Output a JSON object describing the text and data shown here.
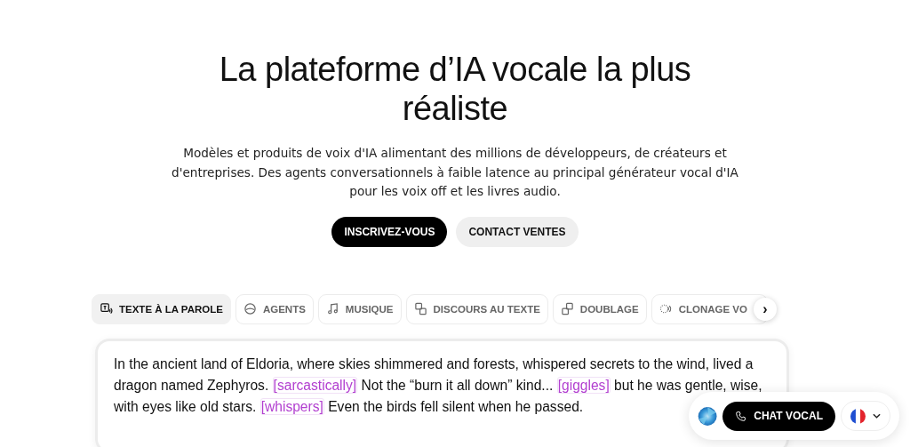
{
  "hero": {
    "title": "La plateforme d’IA vocale la plus réaliste",
    "subtitle": "Modèles et produits de voix d'IA alimentant des millions de développeurs, de créateurs et d'entreprises. Des agents conversationnels à faible latence au principal générateur vocal d'IA pour les voix off et les livres audio.",
    "buttons": [
      {
        "label": "INSCRIVEZ-VOUS",
        "kind": "primary"
      },
      {
        "label": "CONTACT VENTES",
        "kind": "secondary"
      }
    ]
  },
  "tabs": [
    {
      "label": "TEXTE À LA PAROLE",
      "kind": "tts",
      "selected": true
    },
    {
      "label": "AGENTS",
      "kind": "agents",
      "selected": false
    },
    {
      "label": "MUSIQUE",
      "kind": "music",
      "selected": false
    },
    {
      "label": "DISCOURS AU TEXTE",
      "kind": "stt",
      "selected": false
    },
    {
      "label": "DOUBLAGE",
      "kind": "dub",
      "selected": false
    },
    {
      "label": "CLONAGE VO",
      "kind": "clone",
      "selected": false
    }
  ],
  "tabs_next": "›",
  "editor": {
    "passage": [
      {
        "kind": "text",
        "text": "In the ancient land of Eldoria, where skies shimmered and forests, whispered secrets to the wind, lived a dragon named Zephyros. "
      },
      {
        "kind": "tag",
        "text": "[sarcastically]"
      },
      {
        "kind": "text",
        "text": " Not the “burn it all down” kind... "
      },
      {
        "kind": "tag",
        "text": "[giggles]"
      },
      {
        "kind": "text",
        "text": " but he was gentle, wise, with eyes like old stars. "
      },
      {
        "kind": "tag",
        "text": "[whispers]"
      },
      {
        "kind": "text",
        "text": " Even the birds fell silent when he passed."
      }
    ]
  },
  "voice_widget": {
    "button": "CHAT VOCAL"
  }
}
